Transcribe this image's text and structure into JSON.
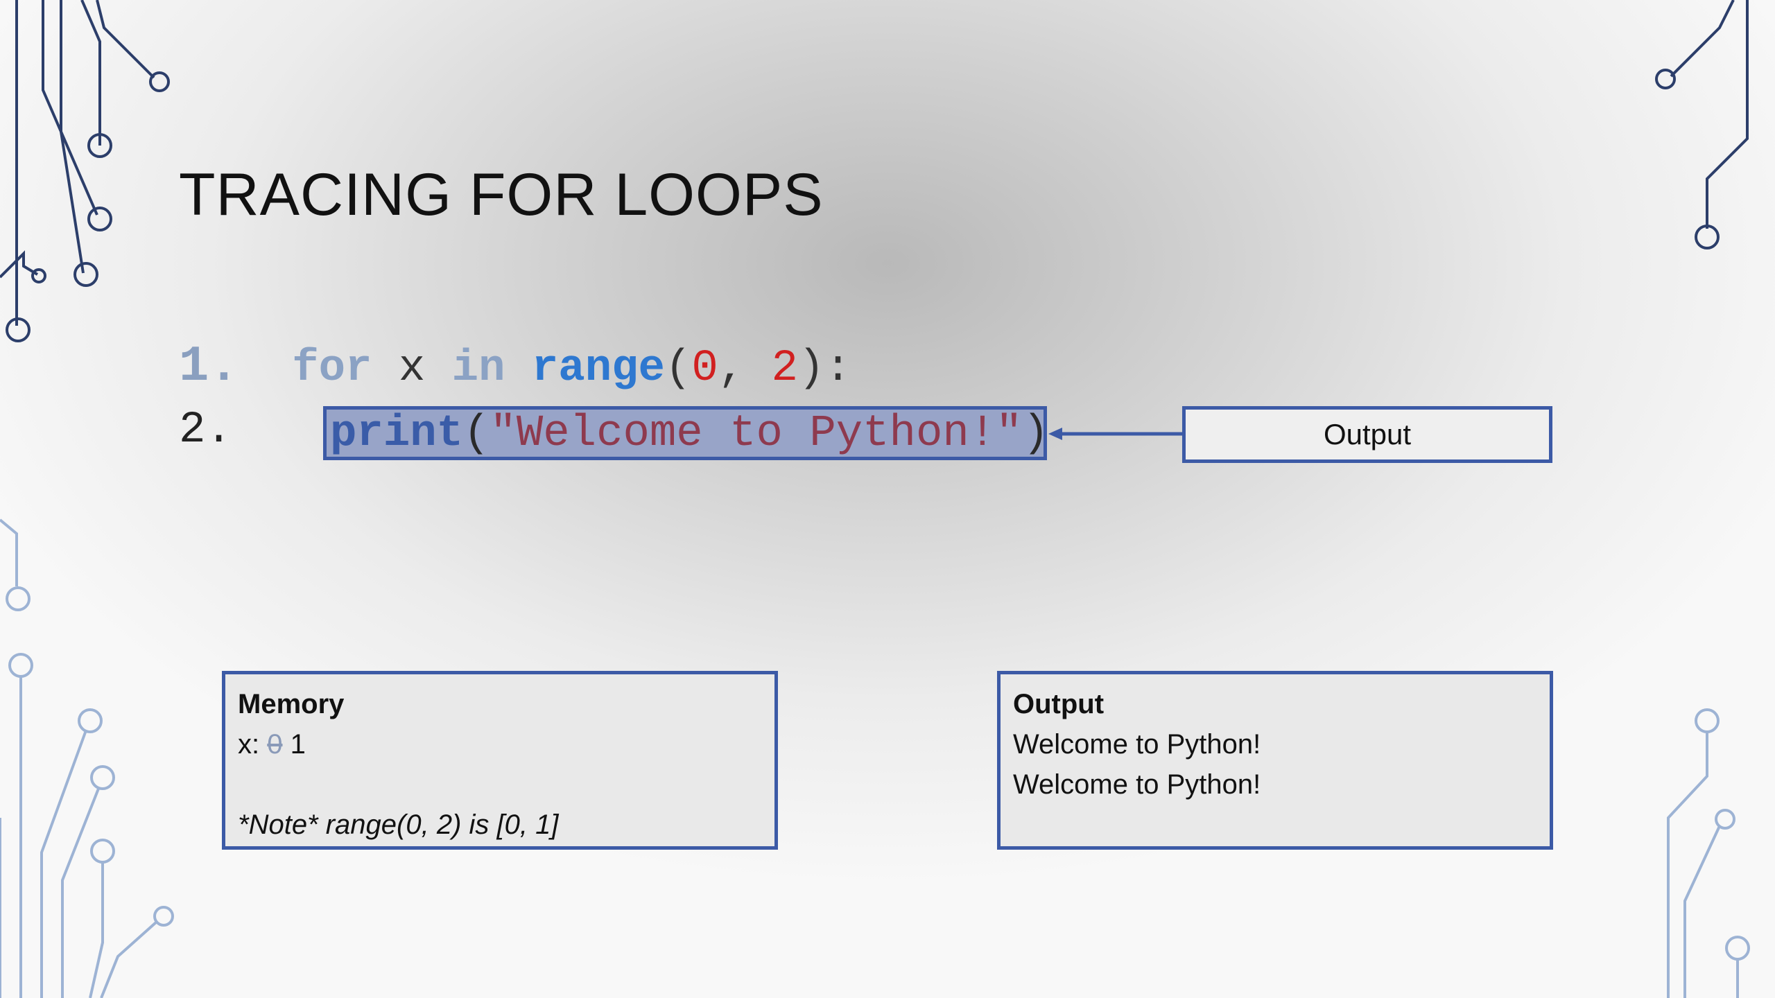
{
  "slide": {
    "title": "Tracing for Loops"
  },
  "code": {
    "line1": {
      "number": "1.",
      "kw_for": "for",
      "var": "x",
      "kw_in": "in",
      "fn": "range",
      "open": "(",
      "arg1": "0",
      "comma": ",",
      "arg2": "2",
      "close": "):"
    },
    "line2": {
      "number": "2.",
      "fn": "print",
      "open": "(",
      "string": "\"Welcome to Python!\"",
      "close": ")"
    }
  },
  "output_label": "Output",
  "memory": {
    "heading": "Memory",
    "var_label": "x:",
    "old_value": "0",
    "new_value": "1",
    "note": "*Note* range(0, 2) is [0, 1]"
  },
  "output_box": {
    "heading": "Output",
    "lines": [
      "Welcome to Python!",
      "Welcome to Python!"
    ]
  },
  "colors": {
    "accent": "#3c5aa6",
    "highlight": "#98a4c8",
    "number": "#d12020",
    "function": "#2e78d0"
  }
}
